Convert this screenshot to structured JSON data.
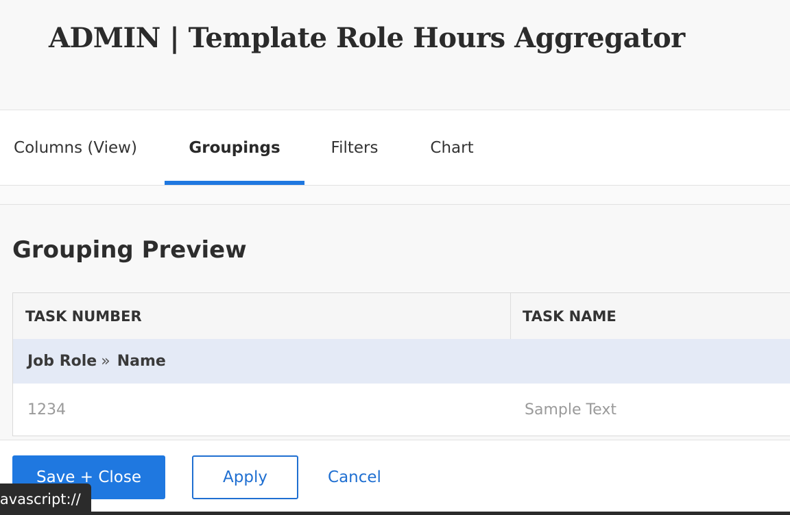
{
  "header": {
    "title": "ADMIN | Template Role Hours Aggregator"
  },
  "tabs": [
    {
      "label": "Columns (View)",
      "active": false
    },
    {
      "label": "Groupings",
      "active": true
    },
    {
      "label": "Filters",
      "active": false
    },
    {
      "label": "Chart",
      "active": false
    }
  ],
  "preview": {
    "title": "Grouping Preview",
    "columns": [
      "TASK NUMBER",
      "TASK NAME"
    ],
    "group_row": {
      "first": "Job Role",
      "separator": "»",
      "second": "Name"
    },
    "rows": [
      {
        "task_number": "1234",
        "task_name": "Sample Text"
      }
    ]
  },
  "footer": {
    "save_close_label": "Save + Close",
    "apply_label": "Apply",
    "cancel_label": "Cancel"
  },
  "status_bar": {
    "url_text": "javascript://"
  },
  "colors": {
    "accent": "#1f78e0",
    "group_row_bg": "#e4eaf6"
  }
}
